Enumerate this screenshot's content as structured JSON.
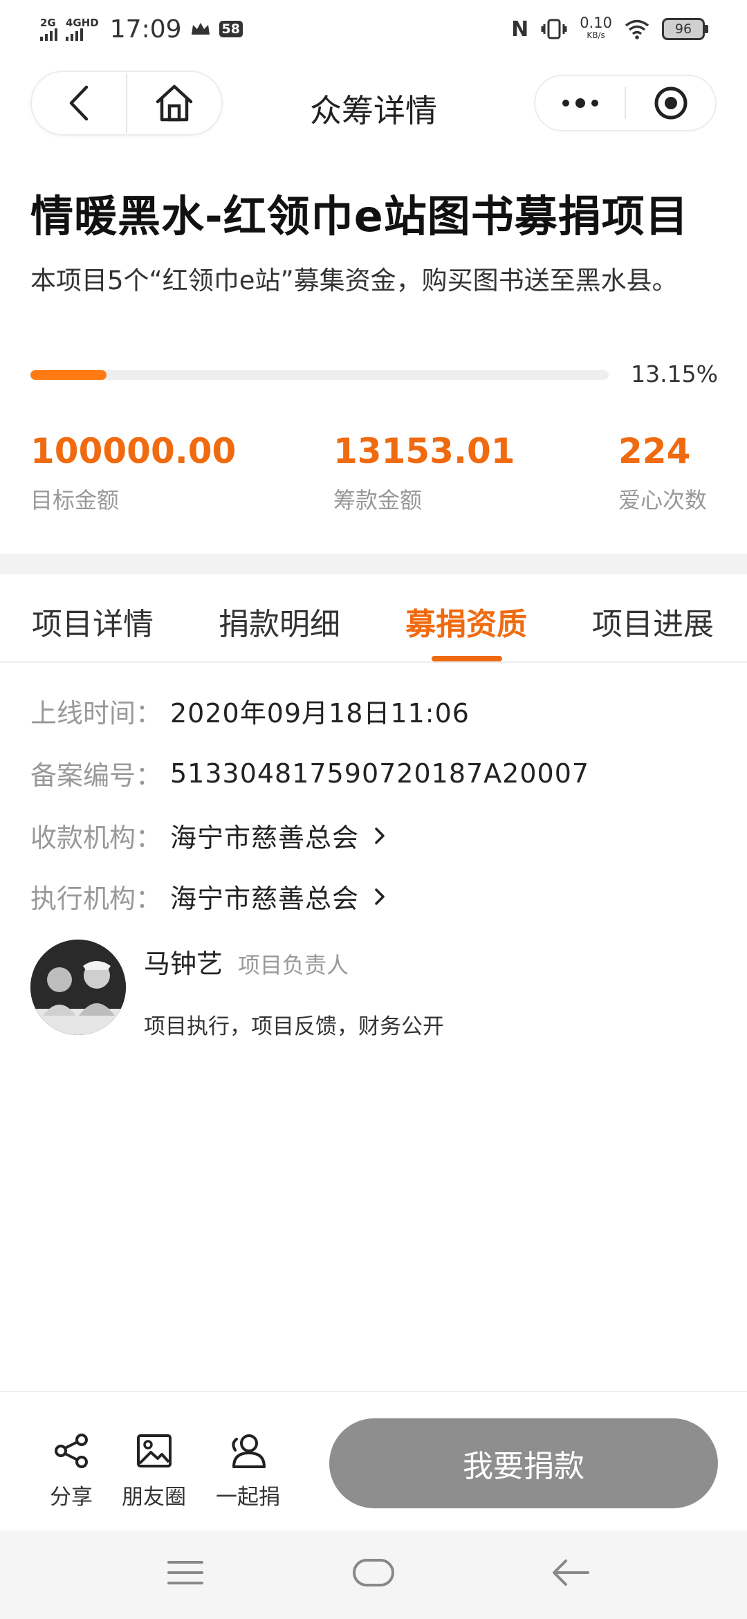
{
  "status_bar": {
    "sim1": "2G",
    "sim2": "4GHD",
    "time": "17:09",
    "badge": "58",
    "nfc": "N",
    "speed_value": "0.10",
    "speed_unit": "KB/s",
    "battery": "96"
  },
  "navbar": {
    "title": "众筹详情"
  },
  "project": {
    "title": "情暖黑水-红领巾e站图书募捐项目",
    "description": "本项目5个“红领巾e站”募集资金，购买图书送至黑水县。",
    "progress_percent_text": "13.15%",
    "progress_fraction": 0.1315
  },
  "stats": [
    {
      "value": "100000.00",
      "label": "目标金额"
    },
    {
      "value": "13153.01",
      "label": "筹款金额"
    },
    {
      "value": "224",
      "label": "爱心次数"
    }
  ],
  "tabs": [
    {
      "label": "项目详情",
      "active": false
    },
    {
      "label": "捐款明细",
      "active": false
    },
    {
      "label": "募捐资质",
      "active": true
    },
    {
      "label": "项目进展",
      "active": false
    }
  ],
  "info": {
    "online_time_label": "上线时间：",
    "online_time": "2020年09月18日11:06",
    "record_no_label": "备案编号：",
    "record_no": "51330481759072018 7A20007",
    "receiver_label": "收款机构：",
    "receiver": "海宁市慈善总会",
    "executor_label": "执行机构：",
    "executor": "海宁市慈善总会"
  },
  "person": {
    "name": "马钟艺",
    "role": "项目负责人",
    "duties": "项目执行，项目反馈，财务公开"
  },
  "bottom": {
    "share": "分享",
    "moments": "朋友圈",
    "together": "一起捐",
    "donate": "我要捐款"
  },
  "colors": {
    "accent": "#f06a10",
    "progress": "#ff7a13",
    "donate_button": "#8e8e8e"
  }
}
